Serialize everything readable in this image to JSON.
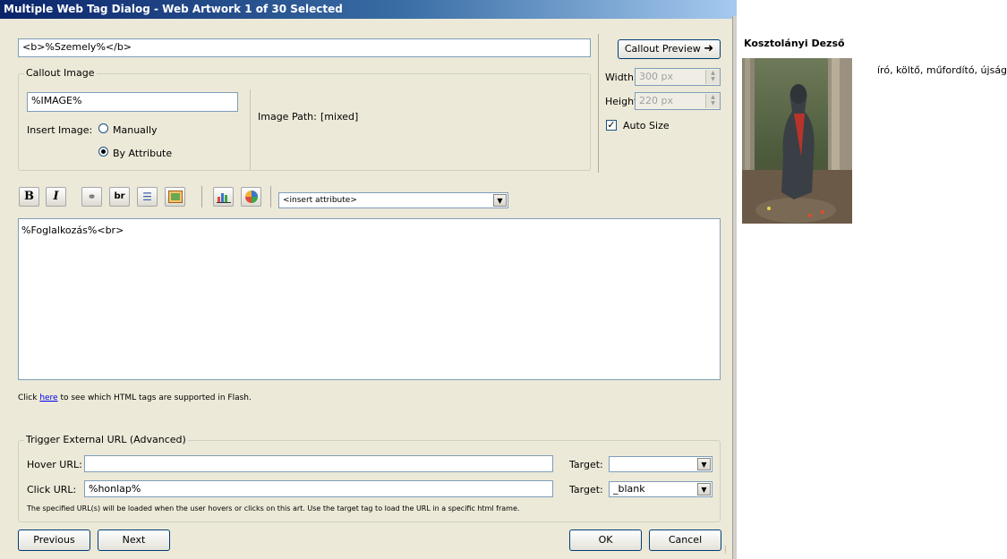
{
  "dialog": {
    "title": "Multiple Web Tag Dialog - Web Artwork 1 of 30 Selected"
  },
  "top_field": {
    "value": "<b>%Szemely%</b>"
  },
  "callout_preview_button": "Callout Preview",
  "callout_image": {
    "group_label": "Callout Image",
    "image_field": "%IMAGE%",
    "insert_image_label": "Insert Image:",
    "option_manually": "Manually",
    "option_by_attribute": "By Attribute",
    "selected_option": "By Attribute",
    "image_path_label": "Image Path:",
    "image_path_value": "[mixed]"
  },
  "size": {
    "width_label": "Width:",
    "width_value": "300 px",
    "height_label": "Height:",
    "height_value": "220 px",
    "auto_size_label": "Auto Size",
    "auto_size_checked": true
  },
  "toolbar": {
    "bold_label": "B",
    "italic_label": "I",
    "br_label": "br",
    "insert_attribute_placeholder": "<insert attribute>"
  },
  "editor": {
    "content": "%Foglalkozás%<br>"
  },
  "help": {
    "prefix": "Click ",
    "link_text": "here",
    "suffix": " to see which HTML tags are supported in Flash."
  },
  "trigger": {
    "group_label": "Trigger External URL (Advanced)",
    "hover_label": "Hover URL:",
    "hover_value": "",
    "click_label": "Click URL:",
    "click_value": "%honlap%",
    "target_label": "Target:",
    "hover_target": "",
    "click_target": "_blank",
    "note": "The specified URL(s) will be loaded when the user hovers or clicks on this art. Use the target tag to load the URL in a specific html frame."
  },
  "buttons": {
    "previous": "Previous",
    "next": "Next",
    "ok": "OK",
    "cancel": "Cancel"
  },
  "preview": {
    "name": "Kosztolányi Dezső",
    "description": "író, költő, műfordító, újságíró"
  },
  "colors": {
    "dialog_bg": "#ece9d8",
    "title_start": "#0a246a",
    "title_end": "#a6caf0",
    "field_border": "#7f9db9",
    "link": "#0000ee"
  }
}
